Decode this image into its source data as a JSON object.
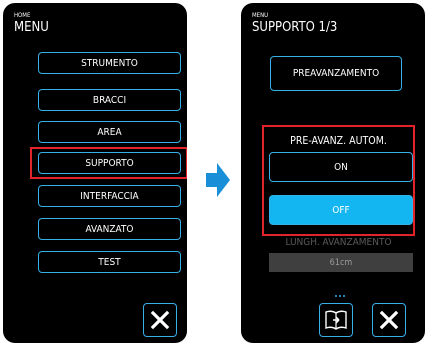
{
  "left": {
    "breadcrumb": "HOME",
    "title": "MENU",
    "menu_items": [
      "STRUMENTO",
      "BRACCI",
      "AREA",
      "SUPPORTO",
      "INTERFACCIA",
      "AVANZATO",
      "TEST"
    ],
    "highlighted_item": "SUPPORTO"
  },
  "right": {
    "breadcrumb": "MENU",
    "title": "SUPPORTO 1/3",
    "preavanzamento_label": "PREAVANZAMENTO",
    "pre_avanz_label": "PRE-AVANZ. AUTOM.",
    "on_label": "ON",
    "off_label": "OFF",
    "selected_option": "OFF",
    "lungh_label": "LUNGH. AVANZAMENTO",
    "length_value": "61cm"
  },
  "colors": {
    "accent_blue": "#35b0e8",
    "selected_fill": "#13b6f0",
    "highlight_red": "#e0242a",
    "arrow_blue": "#1a8fd8"
  },
  "icons": {
    "close": "close-icon",
    "guide": "book-icon",
    "transition": "arrow-right-icon"
  }
}
